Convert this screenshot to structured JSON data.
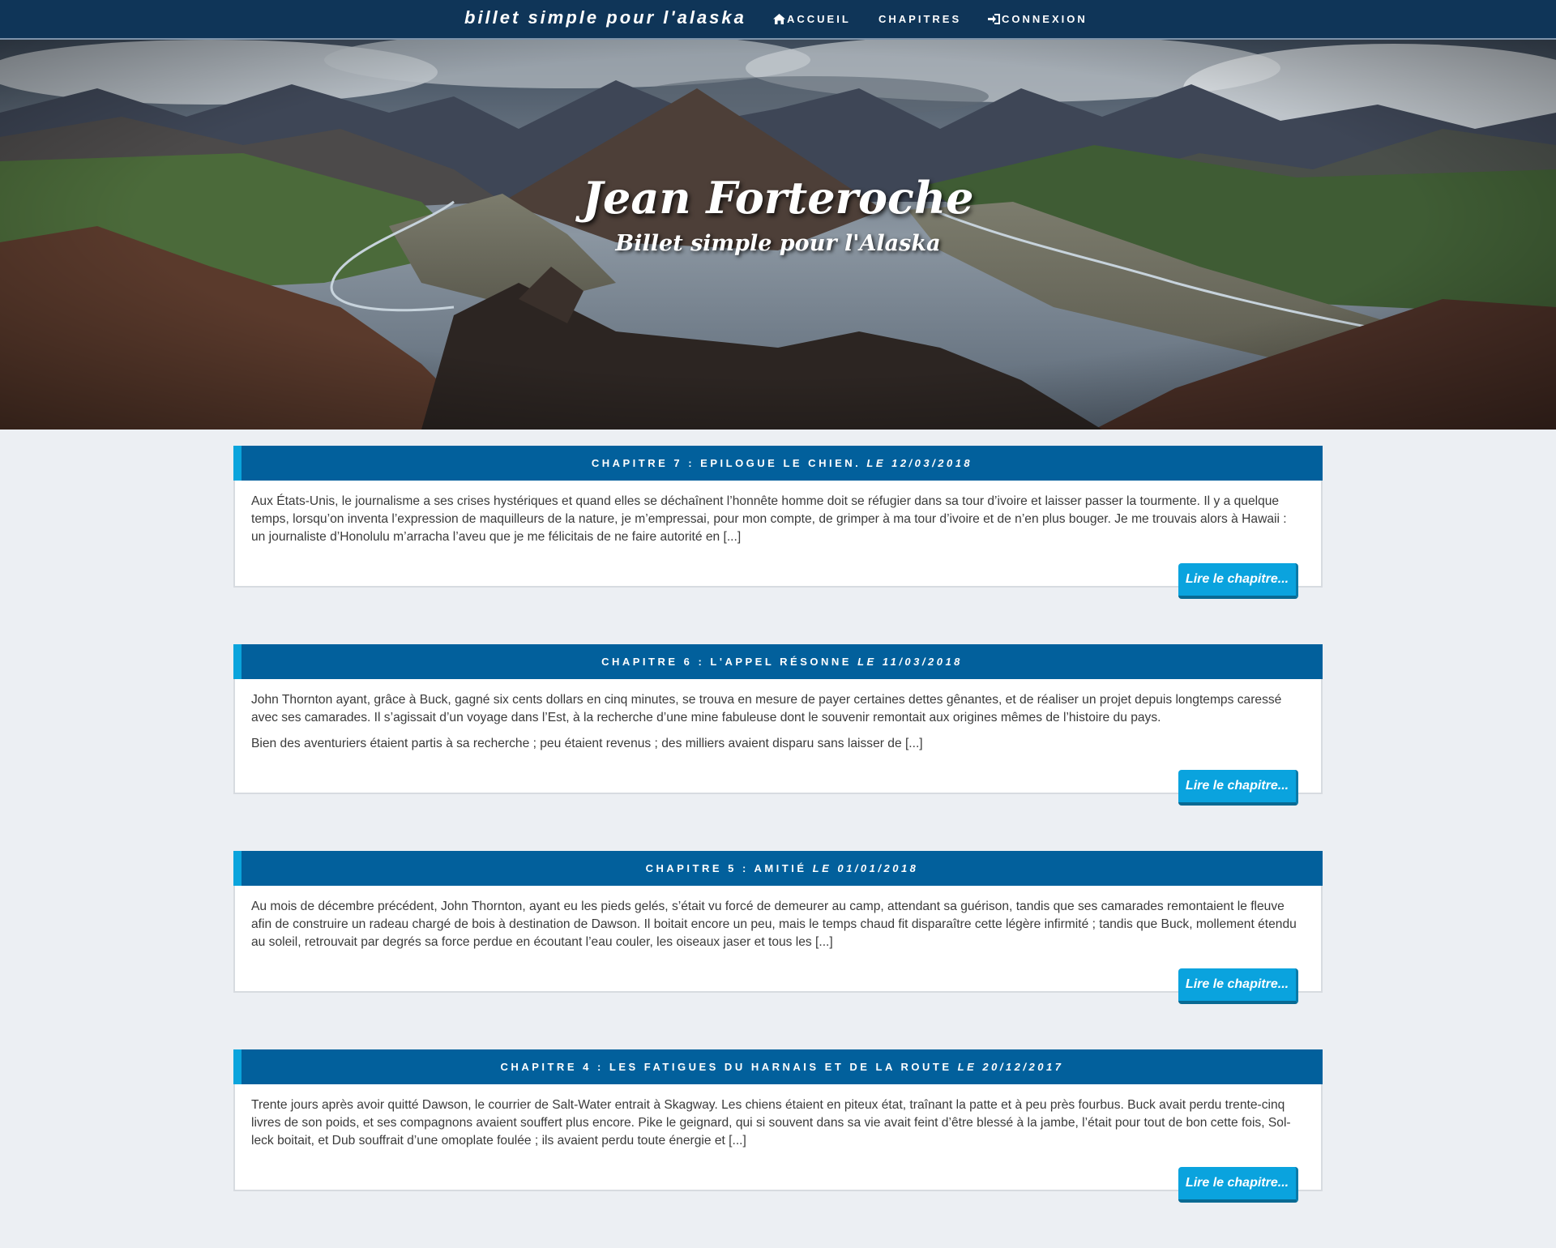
{
  "navbar": {
    "brand": "billet simple pour l'alaska",
    "items": [
      {
        "label": "Accueil",
        "icon": "home-icon"
      },
      {
        "label": "Chapitres",
        "icon": ""
      },
      {
        "label": "Connexion",
        "icon": "sign-in-icon"
      }
    ]
  },
  "hero": {
    "title": "Jean Forteroche",
    "subtitle": "Billet simple pour l'Alaska"
  },
  "colors": {
    "navbar_bg": "#0f3558",
    "card_header_bg": "#02609c",
    "card_header_accent": "#0aa4dc",
    "button_bg": "#0aa3de",
    "page_bg": "#eceff3"
  },
  "chapters": [
    {
      "heading": "Chapitre 7 : Epilogue le chien.",
      "date": "le 12/03/2018",
      "paragraphs": [
        "Aux États-Unis, le journalisme a ses crises hystériques et quand elles se déchaînent l’honnête homme doit se réfugier dans sa tour d’ivoire et laisser passer la tourmente. Il y a quelque temps, lorsqu’on inventa l’expression de maquilleurs de la nature, je m’empressai, pour mon compte, de grimper à ma tour d’ivoire et de n’en plus bouger. Je me trouvais alors à Hawaii : un journaliste d’Honolulu m’arracha l’aveu que je me félicitais de ne faire autorité en [...]"
      ],
      "button": "Lire le chapitre..."
    },
    {
      "heading": "Chapitre 6 : L'appel résonne",
      "date": "le 11/03/2018",
      "paragraphs": [
        "John Thornton ayant, grâce à Buck, gagné six cents dollars en cinq minutes, se trouva en mesure de payer certaines dettes gênantes, et de réaliser un projet depuis longtemps caressé avec ses camarades. Il s’agissait d’un voyage dans l’Est, à la recherche d’une mine fabuleuse dont le souvenir remontait aux origines mêmes de l’histoire du pays.",
        "Bien des aventuriers étaient partis à sa recherche ; peu étaient revenus ; des milliers avaient disparu sans laisser de [...]"
      ],
      "button": "Lire le chapitre..."
    },
    {
      "heading": "Chapitre 5 : Amitié",
      "date": "le 01/01/2018",
      "paragraphs": [
        "Au mois de décembre précédent, John Thornton, ayant eu les pieds gelés, s’était vu forcé de demeurer au camp, attendant sa guérison, tandis que ses camarades remontaient le fleuve afin de construire un radeau chargé de bois à destination de Dawson. Il boitait encore un peu, mais le temps chaud fit disparaître cette légère infirmité ; tandis que Buck, mollement étendu au soleil, retrouvait par degrés sa force perdue en écoutant l’eau couler, les oiseaux jaser et tous les [...]"
      ],
      "button": "Lire le chapitre..."
    },
    {
      "heading": "Chapitre 4 : Les fatigues du harnais et de la route",
      "date": "le 20/12/2017",
      "paragraphs": [
        "Trente jours après avoir quitté Dawson, le courrier de Salt-Water entrait à Skagway. Les chiens étaient en piteux état, traînant la patte et à peu près fourbus. Buck avait perdu trente-cinq livres de son poids, et ses compagnons avaient souffert plus encore. Pike le geignard, qui si souvent dans sa vie avait feint d’être blessé à la jambe, l’était pour tout de bon cette fois, Sol-leck boitait, et Dub souffrait d’une omoplate foulée ; ils avaient perdu toute énergie et [...]"
      ],
      "button": "Lire le chapitre..."
    }
  ]
}
